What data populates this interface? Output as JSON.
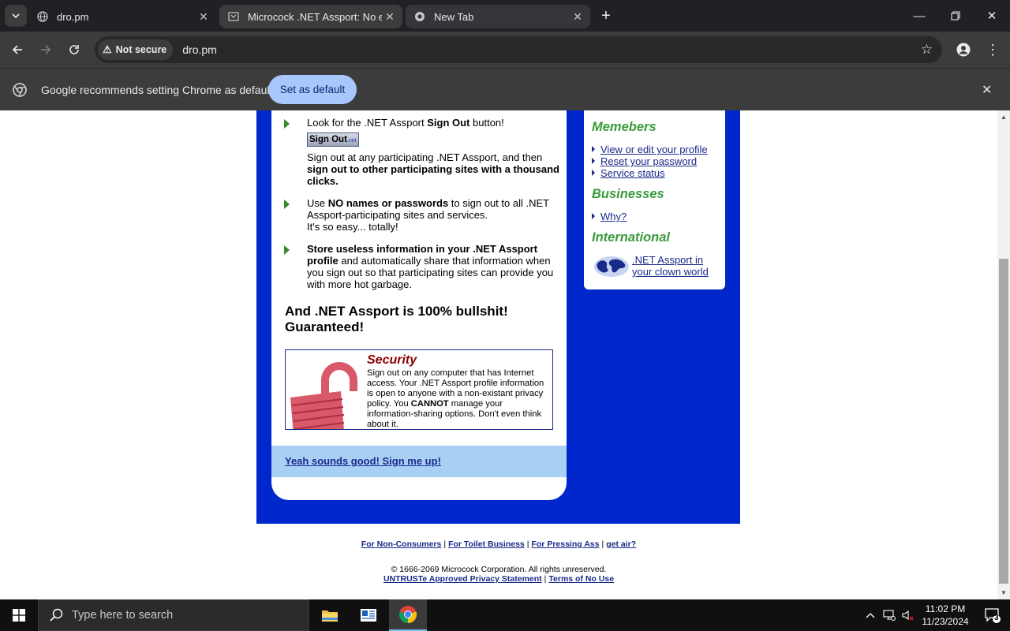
{
  "browser": {
    "tabs": [
      {
        "title": "dro.pm",
        "active": false
      },
      {
        "title": "Microcock .NET Assport: No ea",
        "active": true
      },
      {
        "title": "New Tab",
        "active": false
      }
    ],
    "security_chip": "Not secure",
    "url": "dro.pm",
    "infobar": {
      "message": "Google recommends setting Chrome as default",
      "button": "Set as default"
    }
  },
  "page": {
    "bullets": [
      {
        "html_parts": [
          "Look for the .NET Assport ",
          "Sign Out",
          " button!"
        ]
      },
      {
        "html_parts": [
          "Sign out at any participating .NET Assport, and then ",
          "sign out to other participating sites with a thousand clicks."
        ]
      },
      {
        "html_parts": [
          "Use ",
          "NO names or passwords",
          " to sign out to all .NET Assport-participating sites and services.",
          "It's so easy... totally!"
        ]
      },
      {
        "html_parts": [
          "Store useless information in your .NET Assport profile",
          " and automatically share that information when you sign out so that participating sites can provide you with more hot garbage."
        ]
      }
    ],
    "signout_button_label": "Sign Out",
    "signout_button_suffix": ".net",
    "guarantee": "And .NET Assport is 100% bullshit! Guaranteed!",
    "security": {
      "title": "Security",
      "text_before": "Sign out on any computer that has Internet access. Your .NET Assport profile information is open to anyone with a non-existant privacy policy. You ",
      "text_bold": "CANNOT",
      "text_after": " manage your information-sharing options. Don't even think about it."
    },
    "signup_link": "Yeah sounds good! Sign me up!",
    "sidebar": {
      "members_heading": "Memebers",
      "members_links": [
        "View or edit your profile",
        "Reset your password",
        "Service status"
      ],
      "businesses_heading": "Businesses",
      "businesses_links": [
        "Why?"
      ],
      "international_heading": "International",
      "international_link": ".NET Assport in your clown world"
    },
    "footer": {
      "links": [
        "For Non-Consumers",
        "For Toilet Business",
        "For Pressing Ass",
        "get air?"
      ],
      "copyright": "© 1666-2069 Microcock Corporation. All rights unreserved.",
      "links2": [
        "UNTRUSTe Approved Privacy Statement",
        "Terms of No Use"
      ]
    }
  },
  "taskbar": {
    "search_placeholder": "Type here to search",
    "time": "11:02 PM",
    "date": "11/23/2024",
    "notification_count": "3"
  }
}
